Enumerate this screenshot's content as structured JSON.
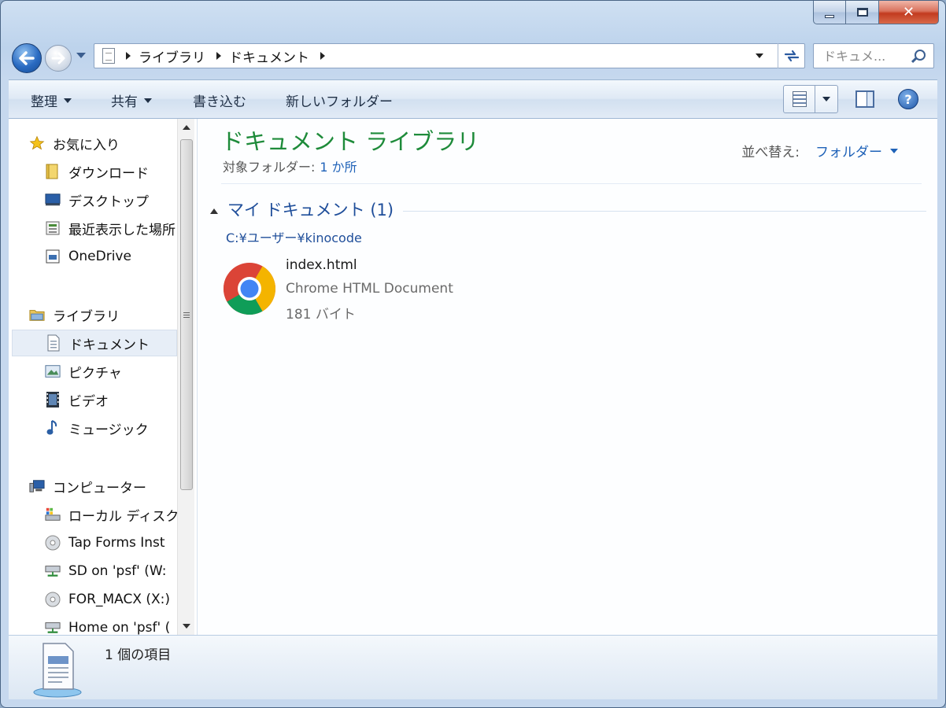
{
  "window": {
    "caption": {
      "minimize": "—",
      "maximize": "□",
      "close": "✕"
    }
  },
  "address": {
    "crumbs": [
      "ライブラリ",
      "ドキュメント"
    ]
  },
  "search": {
    "placeholder": "ドキュメ..."
  },
  "toolbar": {
    "organize": "整理",
    "share": "共有",
    "burn": "書き込む",
    "new_folder": "新しいフォルダー"
  },
  "nav": {
    "favorites": {
      "label": "お気に入り",
      "items": [
        "ダウンロード",
        "デスクトップ",
        "最近表示した場所",
        "OneDrive"
      ]
    },
    "libraries": {
      "label": "ライブラリ",
      "items": [
        "ドキュメント",
        "ピクチャ",
        "ビデオ",
        "ミュージック"
      ]
    },
    "computer": {
      "label": "コンピューター",
      "items": [
        "ローカル ディスク",
        "Tap Forms Inst",
        "SD on 'psf' (W:",
        "FOR_MACX (X:)",
        "Home on 'psf' ("
      ]
    }
  },
  "main": {
    "title": "ドキュメント ライブラリ",
    "includes_label": "対象フォルダー:",
    "includes_link": "1 か所",
    "arrange_label": "並べ替え:",
    "arrange_value": "フォルダー",
    "group": {
      "name": "マイ ドキュメント (1)",
      "path": "C:¥ユーザー¥kinocode"
    },
    "files": [
      {
        "name": "index.html",
        "type": "Chrome HTML Document",
        "size": "181 バイト"
      }
    ]
  },
  "status": {
    "item_count": "1 個の項目"
  },
  "colors": {
    "title_green": "#1e8b3a",
    "link_blue": "#1f62b8",
    "group_blue": "#1f4e9a"
  }
}
